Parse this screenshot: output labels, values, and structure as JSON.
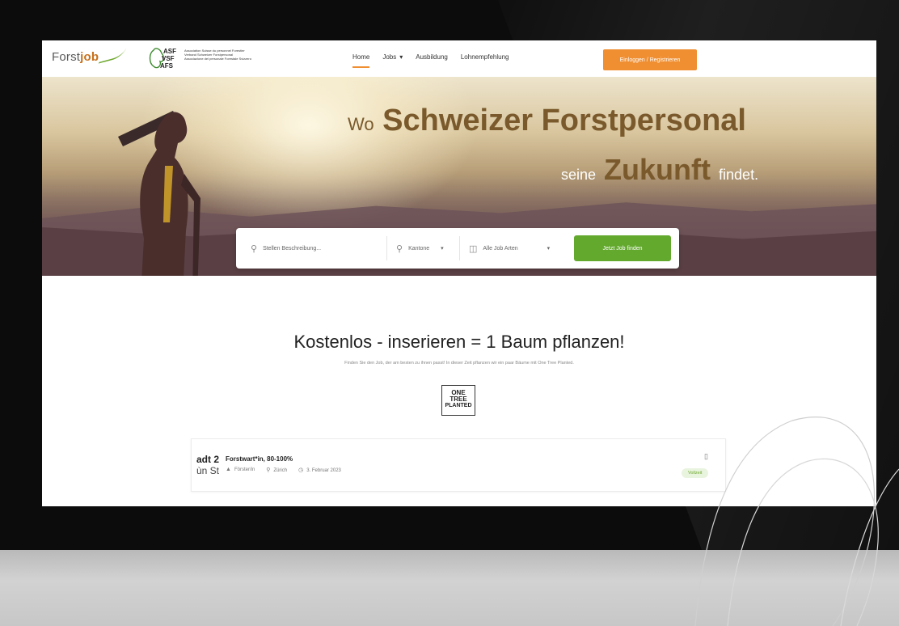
{
  "nav": {
    "logo_part1": "Forst",
    "logo_part2": "job",
    "association_logo_text": "ASF VSF AFS",
    "association_lines": [
      "Association Suisse du personnel Forestier",
      "Verband Schweizer Forstpersonal",
      "Associazione del personale Forestale Svizzero"
    ],
    "menu": [
      "Home",
      "Jobs",
      "Ausbildung",
      "Lohnempfehlung"
    ],
    "login_label": "Einloggen / Registrieren"
  },
  "hero": {
    "line1_small": "Wo",
    "line1_big": "Schweizer Forstpersonal",
    "line2_small": "seine",
    "line2_big": "Zukunft",
    "line2_end": "findet."
  },
  "search": {
    "keyword_placeholder": "Stellen Beschreibung...",
    "canton_label": "Kantone",
    "type_label": "Alle Job Arten",
    "find_label": "Jetzt Job finden"
  },
  "promo": {
    "title": "Kostenlos - inserieren = 1 Baum pflanzen!",
    "subtitle": "Finden Sie den Job, der am besten zu ihnen passt! In dieser Zeit pflanzen wir ein paar Bäume mit One Tree Planted.",
    "otp_lines": [
      "ONE",
      "TREE",
      "PLANTED"
    ]
  },
  "job": {
    "company_line1": "adt 2",
    "company_line2": "ùn St",
    "title": "Forstwart*in, 80-100%",
    "category": "Förster/in",
    "location": "Zürich",
    "date": "3. Februar 2023",
    "badge": "Vollzeit"
  },
  "colors": {
    "accent_orange": "#f08f32",
    "accent_green": "#62a92d",
    "hero_text": "#7a5a2c"
  }
}
